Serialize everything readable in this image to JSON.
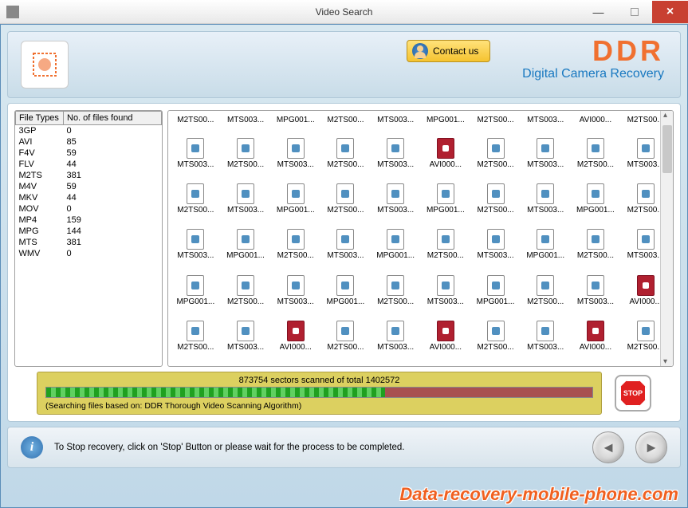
{
  "window": {
    "title": "Video Search"
  },
  "header": {
    "contact_label": "Contact us",
    "brand": "DDR",
    "brand_sub": "Digital Camera Recovery"
  },
  "table": {
    "col1": "File Types",
    "col2": "No. of files found",
    "rows": [
      {
        "type": "3GP",
        "count": "0"
      },
      {
        "type": "AVI",
        "count": "85"
      },
      {
        "type": "F4V",
        "count": "59"
      },
      {
        "type": "FLV",
        "count": "44"
      },
      {
        "type": "M2TS",
        "count": "381"
      },
      {
        "type": "M4V",
        "count": "59"
      },
      {
        "type": "MKV",
        "count": "44"
      },
      {
        "type": "MOV",
        "count": "0"
      },
      {
        "type": "MP4",
        "count": "159"
      },
      {
        "type": "MPG",
        "count": "144"
      },
      {
        "type": "MTS",
        "count": "381"
      },
      {
        "type": "WMV",
        "count": "0"
      }
    ]
  },
  "files": {
    "row0": [
      "M2TS00...",
      "MTS003...",
      "MPG001...",
      "M2TS00...",
      "MTS003...",
      "MPG001...",
      "M2TS00...",
      "MTS003...",
      "AVI000...",
      "M2TS00..."
    ],
    "rows": [
      [
        {
          "n": "MTS003..."
        },
        {
          "n": "M2TS00..."
        },
        {
          "n": "MTS003..."
        },
        {
          "n": "M2TS00..."
        },
        {
          "n": "MTS003..."
        },
        {
          "n": "AVI000...",
          "red": true
        },
        {
          "n": "M2TS00..."
        },
        {
          "n": "MTS003..."
        },
        {
          "n": "M2TS00..."
        },
        {
          "n": "MTS003..."
        }
      ],
      [
        {
          "n": "M2TS00..."
        },
        {
          "n": "MTS003..."
        },
        {
          "n": "MPG001..."
        },
        {
          "n": "M2TS00..."
        },
        {
          "n": "MTS003..."
        },
        {
          "n": "MPG001..."
        },
        {
          "n": "M2TS00..."
        },
        {
          "n": "MTS003..."
        },
        {
          "n": "MPG001..."
        },
        {
          "n": "M2TS00..."
        }
      ],
      [
        {
          "n": "MTS003..."
        },
        {
          "n": "MPG001..."
        },
        {
          "n": "M2TS00..."
        },
        {
          "n": "MTS003..."
        },
        {
          "n": "MPG001..."
        },
        {
          "n": "M2TS00..."
        },
        {
          "n": "MTS003..."
        },
        {
          "n": "MPG001..."
        },
        {
          "n": "M2TS00..."
        },
        {
          "n": "MTS003..."
        }
      ],
      [
        {
          "n": "MPG001..."
        },
        {
          "n": "M2TS00..."
        },
        {
          "n": "MTS003..."
        },
        {
          "n": "MPG001..."
        },
        {
          "n": "M2TS00..."
        },
        {
          "n": "MTS003..."
        },
        {
          "n": "MPG001..."
        },
        {
          "n": "M2TS00..."
        },
        {
          "n": "MTS003..."
        },
        {
          "n": "AVI000...",
          "red": true
        }
      ],
      [
        {
          "n": "M2TS00..."
        },
        {
          "n": "MTS003..."
        },
        {
          "n": "AVI000...",
          "red": true
        },
        {
          "n": "M2TS00..."
        },
        {
          "n": "MTS003..."
        },
        {
          "n": "AVI000...",
          "red": true
        },
        {
          "n": "M2TS00..."
        },
        {
          "n": "MTS003..."
        },
        {
          "n": "AVI000...",
          "red": true
        },
        {
          "n": "M2TS00..."
        }
      ]
    ]
  },
  "progress": {
    "text": "873754 sectors scanned of total 1402572",
    "algo": "(Searching files based on:  DDR Thorough Video Scanning Algorithm)",
    "stop_label": "STOP"
  },
  "footer": {
    "hint": "To Stop recovery, click on 'Stop' Button or please wait for the process to be completed."
  },
  "watermark": "Data-recovery-mobile-phone.com"
}
